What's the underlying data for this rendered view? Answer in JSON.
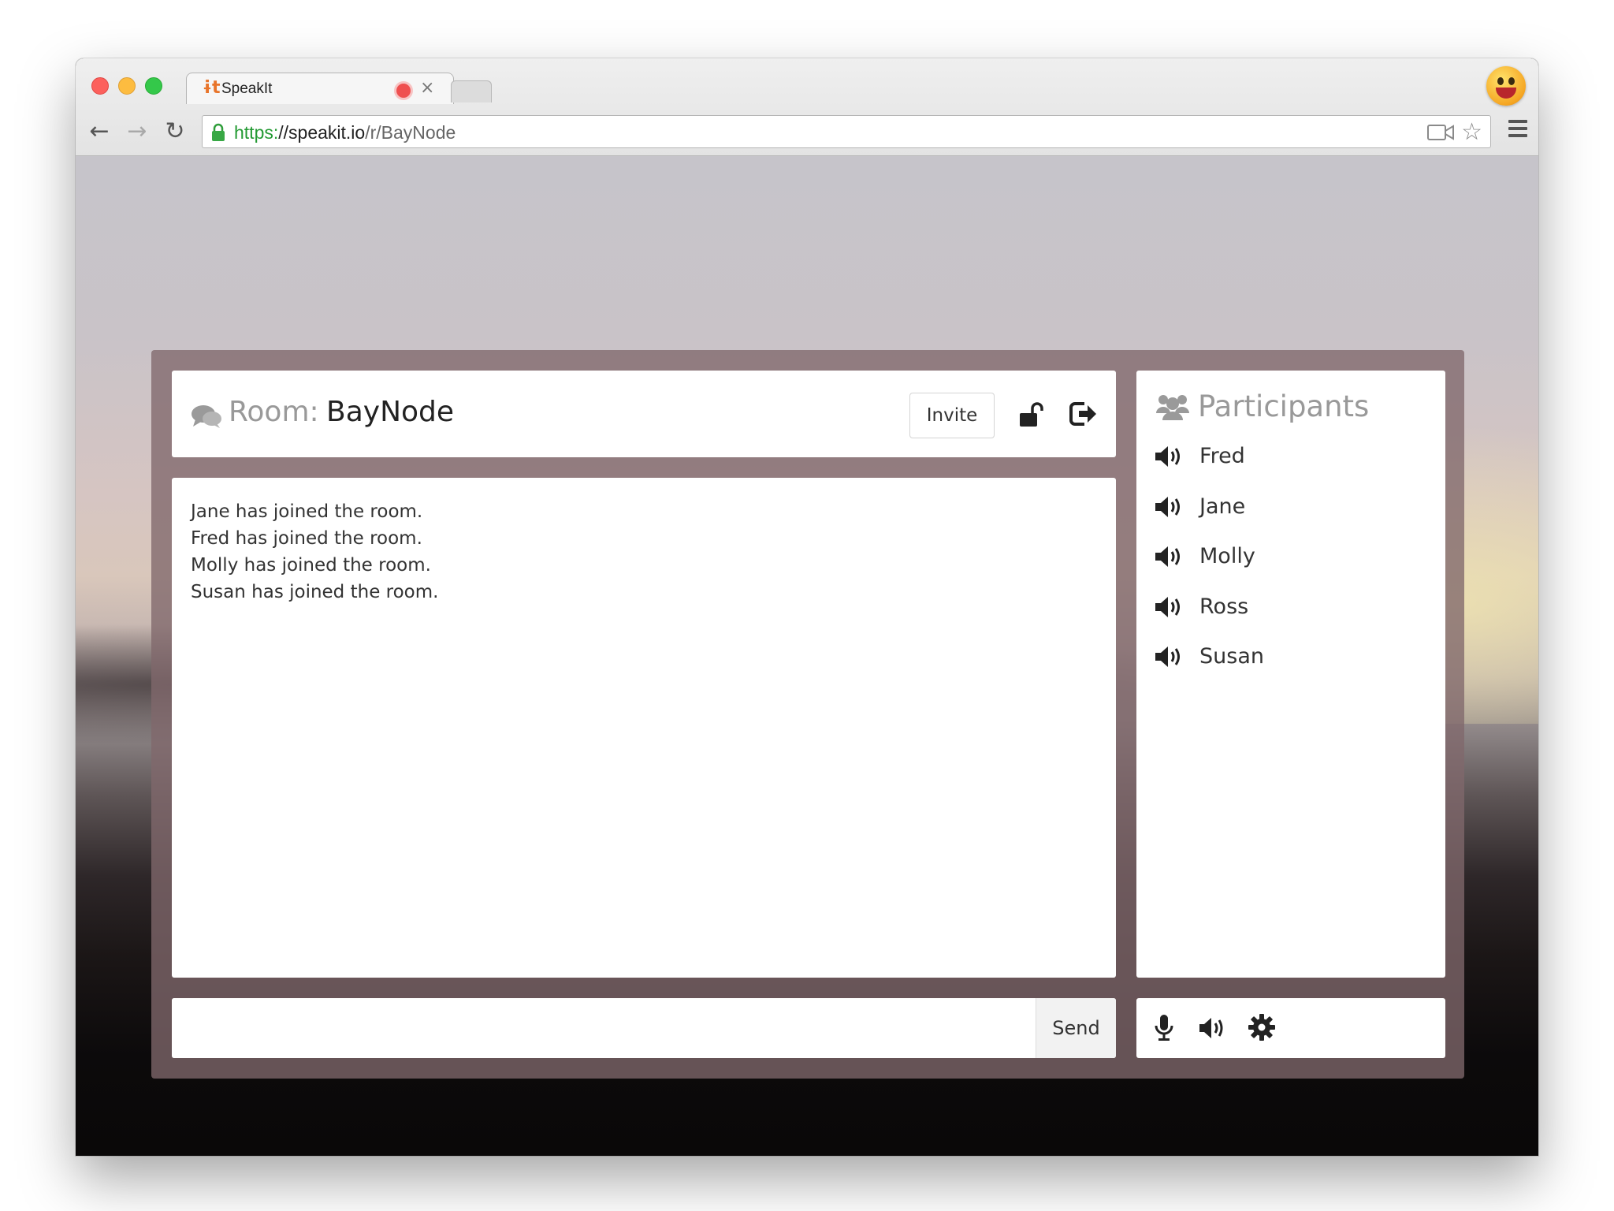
{
  "browser": {
    "tab_title": "SpeakIt",
    "tab_favicon": "ɨt",
    "tab_close": "×",
    "url_scheme": "https:",
    "url_host": "//speakit.io",
    "url_path": "/r/BayNode"
  },
  "icons": {
    "back": "←",
    "forward": "→",
    "reload": "↻",
    "star": "☆"
  },
  "room": {
    "label": "Room:",
    "name": "BayNode",
    "invite_label": "Invite"
  },
  "messages": [
    "Jane has joined the room.",
    "Fred has joined the room.",
    "Molly has joined the room.",
    "Susan has joined the room."
  ],
  "participants": {
    "title": "Participants",
    "names": [
      "Fred",
      "Jane",
      "Molly",
      "Ross",
      "Susan"
    ]
  },
  "composer": {
    "placeholder": "",
    "send_label": "Send"
  },
  "colors": {
    "url_scheme": "#239a33",
    "panel_frame": "#80686c",
    "muted_text": "#999999"
  }
}
